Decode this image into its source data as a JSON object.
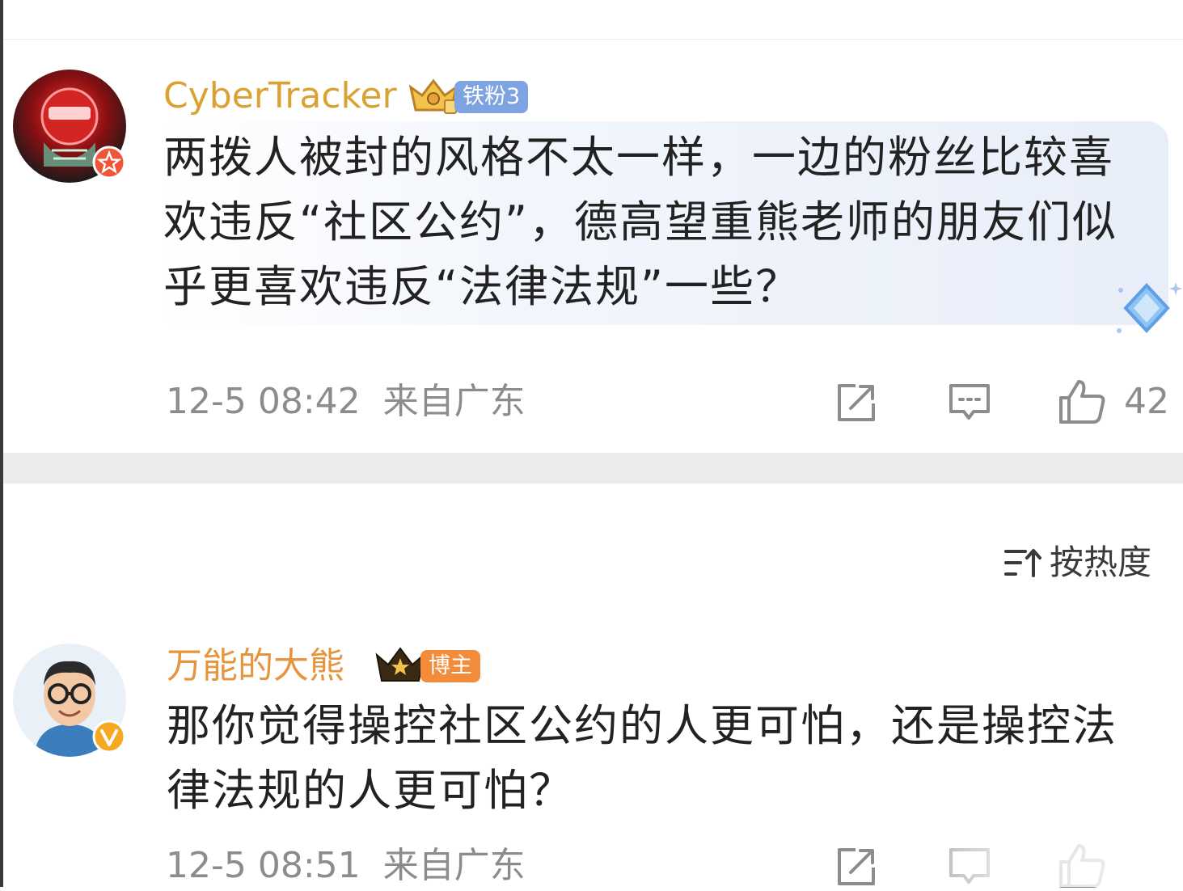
{
  "sort": {
    "label": "按热度",
    "icon": "sort-icon"
  },
  "comments": [
    {
      "username": "CyberTracker",
      "username_color": "#d9a233",
      "fan_badge": "铁粉3",
      "fan_badge_color": "#7da3e0",
      "medal_icon": "crown-medal-icon",
      "avatar_badge_icon": "star-badge-icon",
      "text": "两拨人被封的风格不太一样，一边的粉丝比较喜欢违反“社区公约”，德高望重熊老师的朋友们似乎更喜欢违反“法律法规”一些？",
      "time": "12-5 08:42",
      "location": "来自广东",
      "likes": "42",
      "highlighted": true
    },
    {
      "username": "万能的大熊",
      "username_color": "#e5953d",
      "fan_badge": "博主",
      "fan_badge_color": "#f28b3a",
      "medal_icon": "crown-medal-icon",
      "avatar_badge_icon": "verified-v-icon",
      "text": "那你觉得操控社区公约的人更可怕，还是操控法律法规的人更可怕？",
      "time": "12-5 08:51",
      "location": "来自广东"
    }
  ],
  "colors": {
    "meta": "#8c8c8c",
    "body_text": "#222222",
    "separator": "#ececec"
  }
}
